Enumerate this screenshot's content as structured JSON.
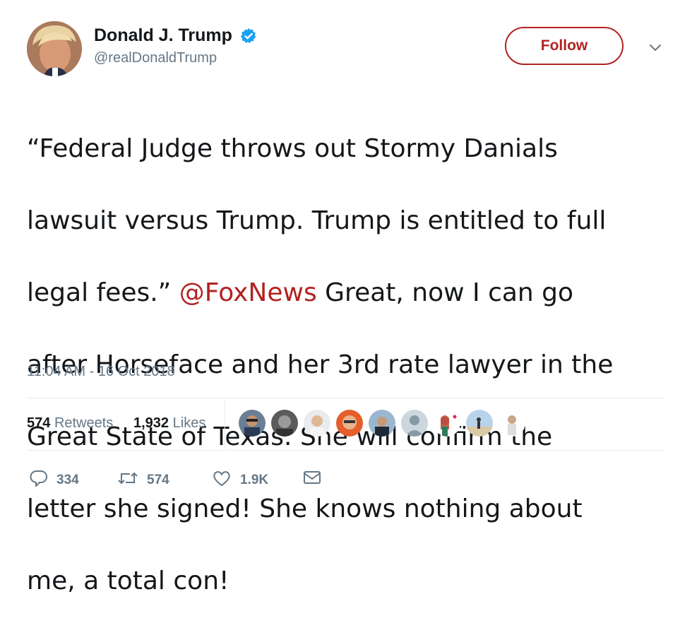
{
  "user": {
    "display_name": "Donald J. Trump",
    "handle": "@realDonaldTrump",
    "avatar_icon": "profile-photo",
    "verified_icon": "verified-badge-icon",
    "verified_color": "#1da1f2"
  },
  "follow_button": {
    "label": "Follow",
    "color": "#b22222"
  },
  "tweet": {
    "lines": [
      {
        "pre": "“Federal Judge throws out Stormy Danials",
        "mention": "",
        "post": ""
      },
      {
        "pre": "lawsuit versus Trump. Trump is entitled to full",
        "mention": "",
        "post": ""
      },
      {
        "pre": "legal fees.” ",
        "mention": "@FoxNews",
        "post": " Great, now I can go"
      },
      {
        "pre": "after Horseface and her 3rd rate lawyer in the",
        "mention": "",
        "post": ""
      },
      {
        "pre": "Great State of Texas. She will confirm the",
        "mention": "",
        "post": ""
      },
      {
        "pre": "letter she signed! She knows nothing about",
        "mention": "",
        "post": ""
      },
      {
        "pre": "me, a total con!",
        "mention": "",
        "post": ""
      }
    ],
    "mention_color": "#b22222"
  },
  "timestamp": "11:04 AM - 16 Oct 2018",
  "stats": {
    "retweets_count": "574",
    "retweets_label": "Retweets",
    "likes_count": "1,932",
    "likes_label": "Likes"
  },
  "actions": {
    "reply_count": "334",
    "retweet_count": "574",
    "like_count": "1.9K",
    "reply_icon": "reply-icon",
    "retweet_icon": "retweet-icon",
    "like_icon": "heart-icon",
    "dm_icon": "envelope-icon"
  }
}
